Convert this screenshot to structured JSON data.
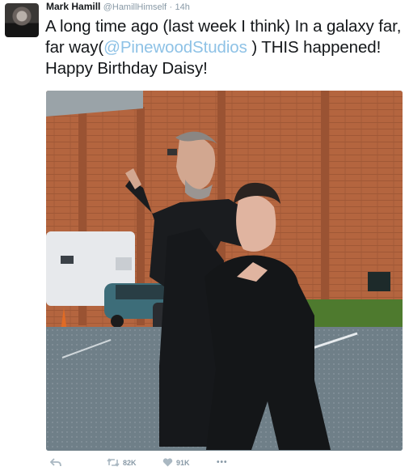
{
  "tweet": {
    "author_name": "Mark Hamill",
    "author_handle": "@HamillHimself",
    "separator": "·",
    "timestamp": "14h",
    "text_part1": "A long time ago (last week I think) In a galaxy far, far way(",
    "mention": "@PinewoodStudios",
    "text_part2": " ) THIS happened! Happy Birthday Daisy!"
  },
  "actions": {
    "reply_icon": "reply-icon",
    "retweet_icon": "retweet-icon",
    "retweet_count": "82K",
    "like_icon": "heart-icon",
    "like_count": "91K",
    "more_icon": "more-icon",
    "more_label": "•••"
  },
  "colors": {
    "text": "#14171a",
    "secondary": "#8899a6",
    "link": "#8ec2e6"
  }
}
